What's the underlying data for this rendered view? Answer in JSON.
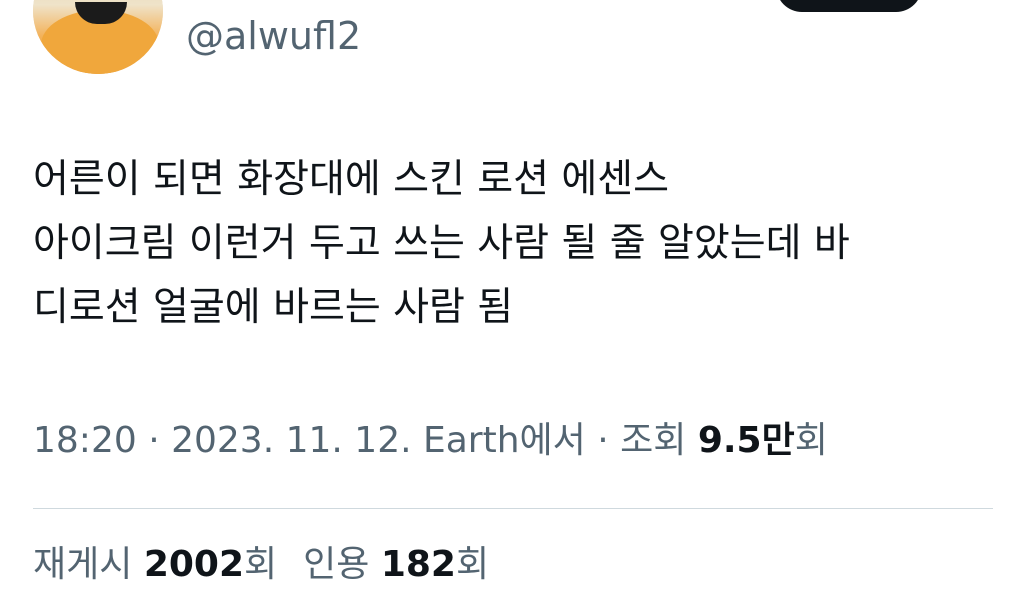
{
  "user": {
    "handle": "@alwufl2"
  },
  "tweet": {
    "text": "어른이 되면 화장대에 스킨 로션 에센스\n아이크림 이런거 두고 쓰는 사람 될 줄 알았는데 바\n디로션 얼굴에 바르는 사람 됨"
  },
  "meta": {
    "time": "18:20",
    "sep1": " · ",
    "date": "2023. 11. 12.",
    "source": " Earth에서",
    "sep2": " · ",
    "views_label": "조회 ",
    "views_number": "9.5만",
    "views_unit": "회"
  },
  "stats": {
    "retweets_label": "재게시 ",
    "retweets_count": "2002",
    "retweets_unit": "회",
    "quotes_label": "인용 ",
    "quotes_count": "182",
    "quotes_unit": "회"
  },
  "colors": {
    "text_primary": "#0f1419",
    "text_secondary": "#536471",
    "divider": "#cfd9de",
    "button_bg": "#0f1419"
  }
}
